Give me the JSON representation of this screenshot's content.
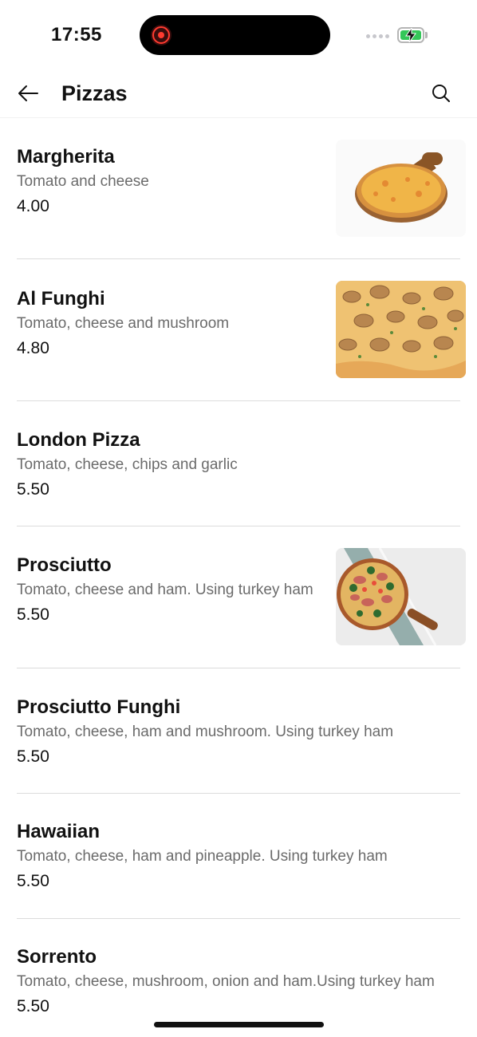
{
  "status_bar": {
    "time": "17:55"
  },
  "header": {
    "title": "Pizzas",
    "back_icon": "arrow-left-icon",
    "search_icon": "search-icon"
  },
  "items": [
    {
      "name": "Margherita",
      "description": "Tomato and cheese",
      "price": "4.00",
      "image": "margherita-pizza-photo"
    },
    {
      "name": "Al Funghi",
      "description": "Tomato, cheese and mushroom",
      "price": "4.80",
      "image": "mushroom-pizza-photo"
    },
    {
      "name": "London Pizza",
      "description": "Tomato, cheese, chips and garlic",
      "price": "5.50"
    },
    {
      "name": "Prosciutto",
      "description": "Tomato, cheese and ham. Using turkey ham",
      "price": "5.50",
      "image": "prosciutto-pizza-photo"
    },
    {
      "name": "Prosciutto Funghi",
      "description": "Tomato, cheese, ham and mushroom. Using turkey ham",
      "price": "5.50"
    },
    {
      "name": "Hawaiian",
      "description": "Tomato, cheese, ham and pineapple. Using turkey ham",
      "price": "5.50"
    },
    {
      "name": "Sorrento",
      "description": "Tomato, cheese, mushroom, onion and ham.Using turkey ham",
      "price": "5.50"
    }
  ],
  "colors": {
    "text": "#111111",
    "secondary_text": "#6b6b6b",
    "divider": "#dcdcdc",
    "battery": "#34c759",
    "record": "#ff3b30"
  }
}
